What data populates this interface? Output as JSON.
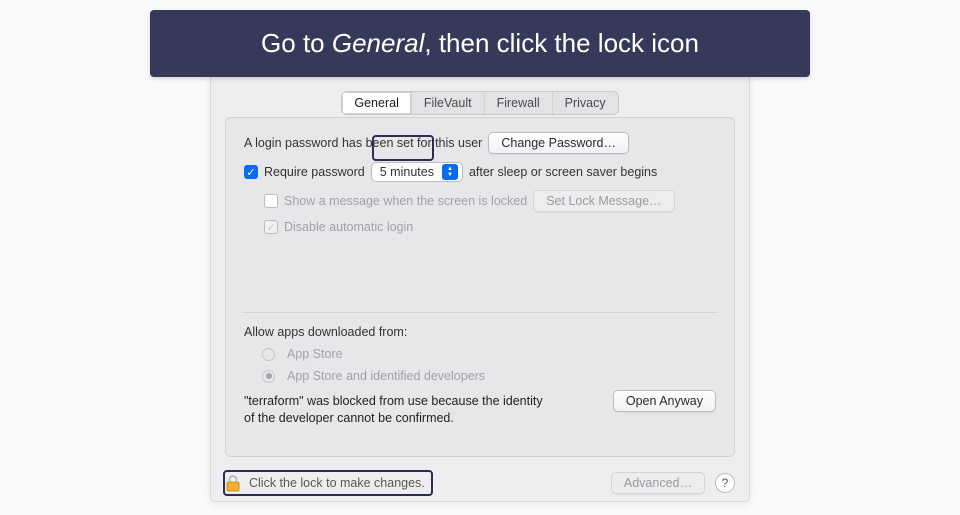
{
  "banner": {
    "prefix": "Go to ",
    "emphasis": "General",
    "suffix": ", then click the lock icon"
  },
  "tabs": {
    "items": [
      "General",
      "FileVault",
      "Firewall",
      "Privacy"
    ],
    "active_index": 0
  },
  "login_password": {
    "text": "A login password has been set for this user",
    "button": "Change Password…"
  },
  "require_password": {
    "checked": true,
    "label_pre": "Require password",
    "delay": "5 minutes",
    "label_post": "after sleep or screen saver begins"
  },
  "lock_message": {
    "checkbox_label": "Show a message when the screen is locked",
    "button": "Set Lock Message…"
  },
  "disable_auto_login": {
    "checked_disabled": true,
    "label": "Disable automatic login"
  },
  "allow_apps": {
    "title": "Allow apps downloaded from:",
    "options": [
      "App Store",
      "App Store and identified developers"
    ],
    "selected_index": 1
  },
  "blocked": {
    "text": "\"terraform\" was blocked from use because the identity of the developer cannot be confirmed.",
    "open_button": "Open Anyway"
  },
  "footer": {
    "lock_text": "Click the lock to make changes.",
    "advanced": "Advanced…",
    "help": "?"
  }
}
